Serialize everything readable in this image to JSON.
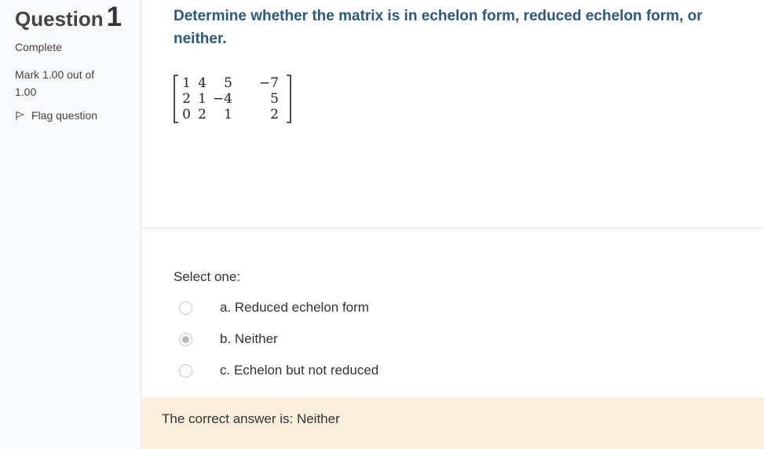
{
  "info": {
    "question_label": "Question",
    "question_number": "1",
    "state": "Complete",
    "grade": "Mark 1.00 out of 1.00",
    "flag_label": "Flag question"
  },
  "question": {
    "text": "Determine whether the matrix is in echelon form, reduced echelon form, or neither.",
    "matrix": [
      [
        "1",
        "4",
        "5",
        "−7"
      ],
      [
        "2",
        "1",
        "−4",
        "5"
      ],
      [
        "0",
        "2",
        "1",
        "2"
      ]
    ]
  },
  "answer": {
    "prompt": "Select one:",
    "options": [
      {
        "label": "a. Reduced echelon form",
        "selected": false
      },
      {
        "label": "b. Neither",
        "selected": true
      },
      {
        "label": "c. Echelon but not reduced",
        "selected": false
      }
    ]
  },
  "feedback": {
    "right_answer": "The correct answer is: Neither"
  },
  "colors": {
    "question_text": "#2d5a78",
    "feedback_bg": "#fcefdc",
    "sidebar_bg": "#f8f9fa"
  }
}
